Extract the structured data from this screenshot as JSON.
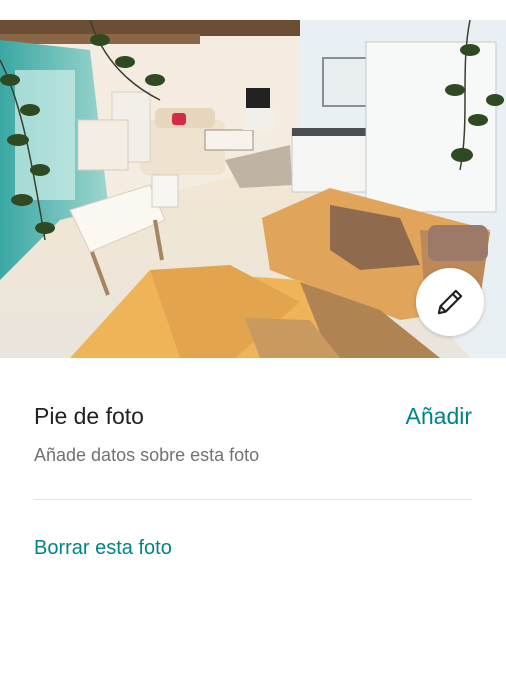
{
  "photo": {
    "subject": "room-photo"
  },
  "edit": {
    "icon": "pencil-icon"
  },
  "caption": {
    "title": "Pie de foto",
    "add_label": "Añadir",
    "hint": "Añade datos sobre esta foto"
  },
  "actions": {
    "delete_label": "Borrar esta foto"
  },
  "colors": {
    "accent": "#00838a",
    "text_primary": "#222222",
    "text_secondary": "#717171",
    "divider": "#e4e4e4"
  }
}
